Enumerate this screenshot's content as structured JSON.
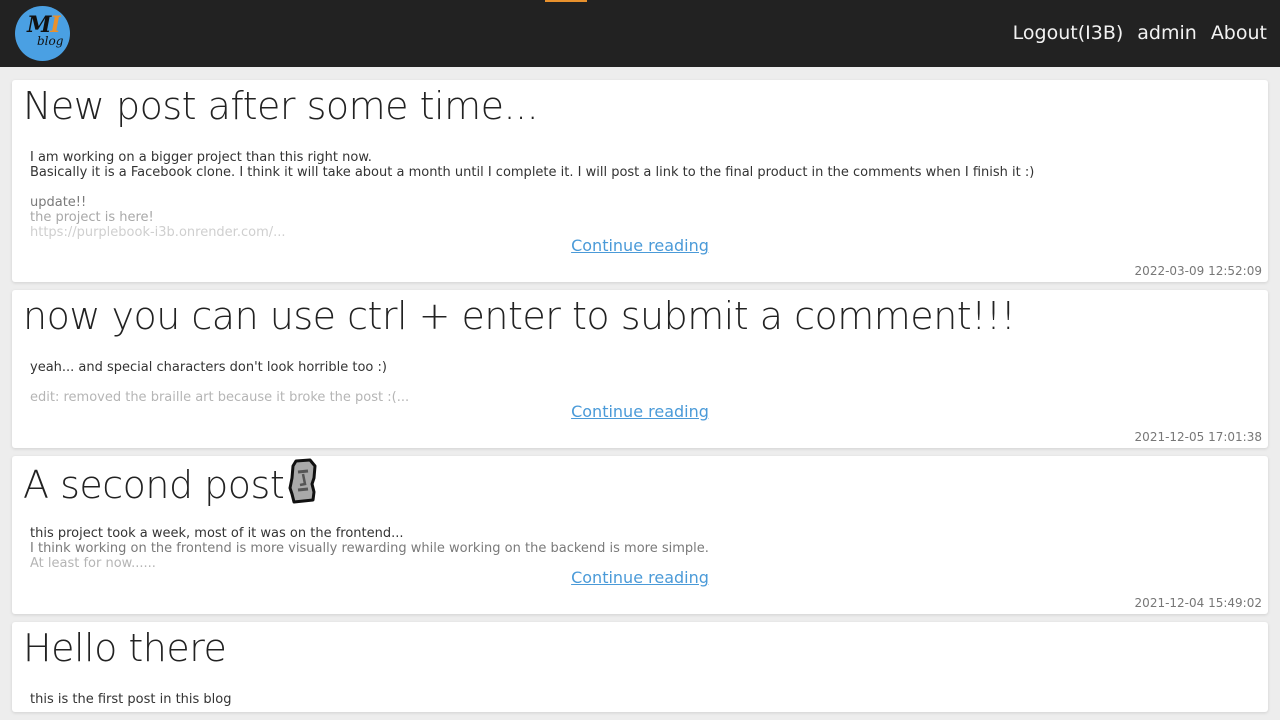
{
  "nav": {
    "logo_main": "M",
    "logo_accent": "I",
    "logo_sub": "blog",
    "links": [
      "Logout(I3B)",
      "admin",
      "About"
    ]
  },
  "posts": [
    {
      "title": "New post after some time...",
      "lines": [
        "I am working on a bigger project than this right now.",
        "Basically it is a Facebook clone. I think it will take about a month until I complete it. I will post a link to the final product in the comments when I finish it :)",
        "",
        "update!!",
        "the project is here!",
        "https://purplebook-i3b.onrender.com/..."
      ],
      "continue": "Continue reading",
      "date": "2022-03-09 12:52:09"
    },
    {
      "title": "now you can use ctrl + enter to submit a comment!!!",
      "lines": [
        "yeah... and special characters don't look horrible too :)",
        "",
        "edit: removed the braille art because it broke the post :(..."
      ],
      "continue": "Continue reading",
      "date": "2021-12-05 17:01:38"
    },
    {
      "title": "A second post",
      "title_icon": "moai-icon",
      "lines": [
        "this project took a week, most of it was on the frontend...",
        "I think working on the frontend is more visually rewarding while working on the backend is more simple.",
        "At least for now......"
      ],
      "continue": "Continue reading",
      "date": "2021-12-04 15:49:02"
    },
    {
      "title": "Hello there",
      "lines": [
        "this is the first post in this blog"
      ]
    }
  ],
  "colors": {
    "navbar": "#222222",
    "accent": "#e8912d",
    "logo": "#4aa0e3",
    "link": "#4a9ad8"
  }
}
